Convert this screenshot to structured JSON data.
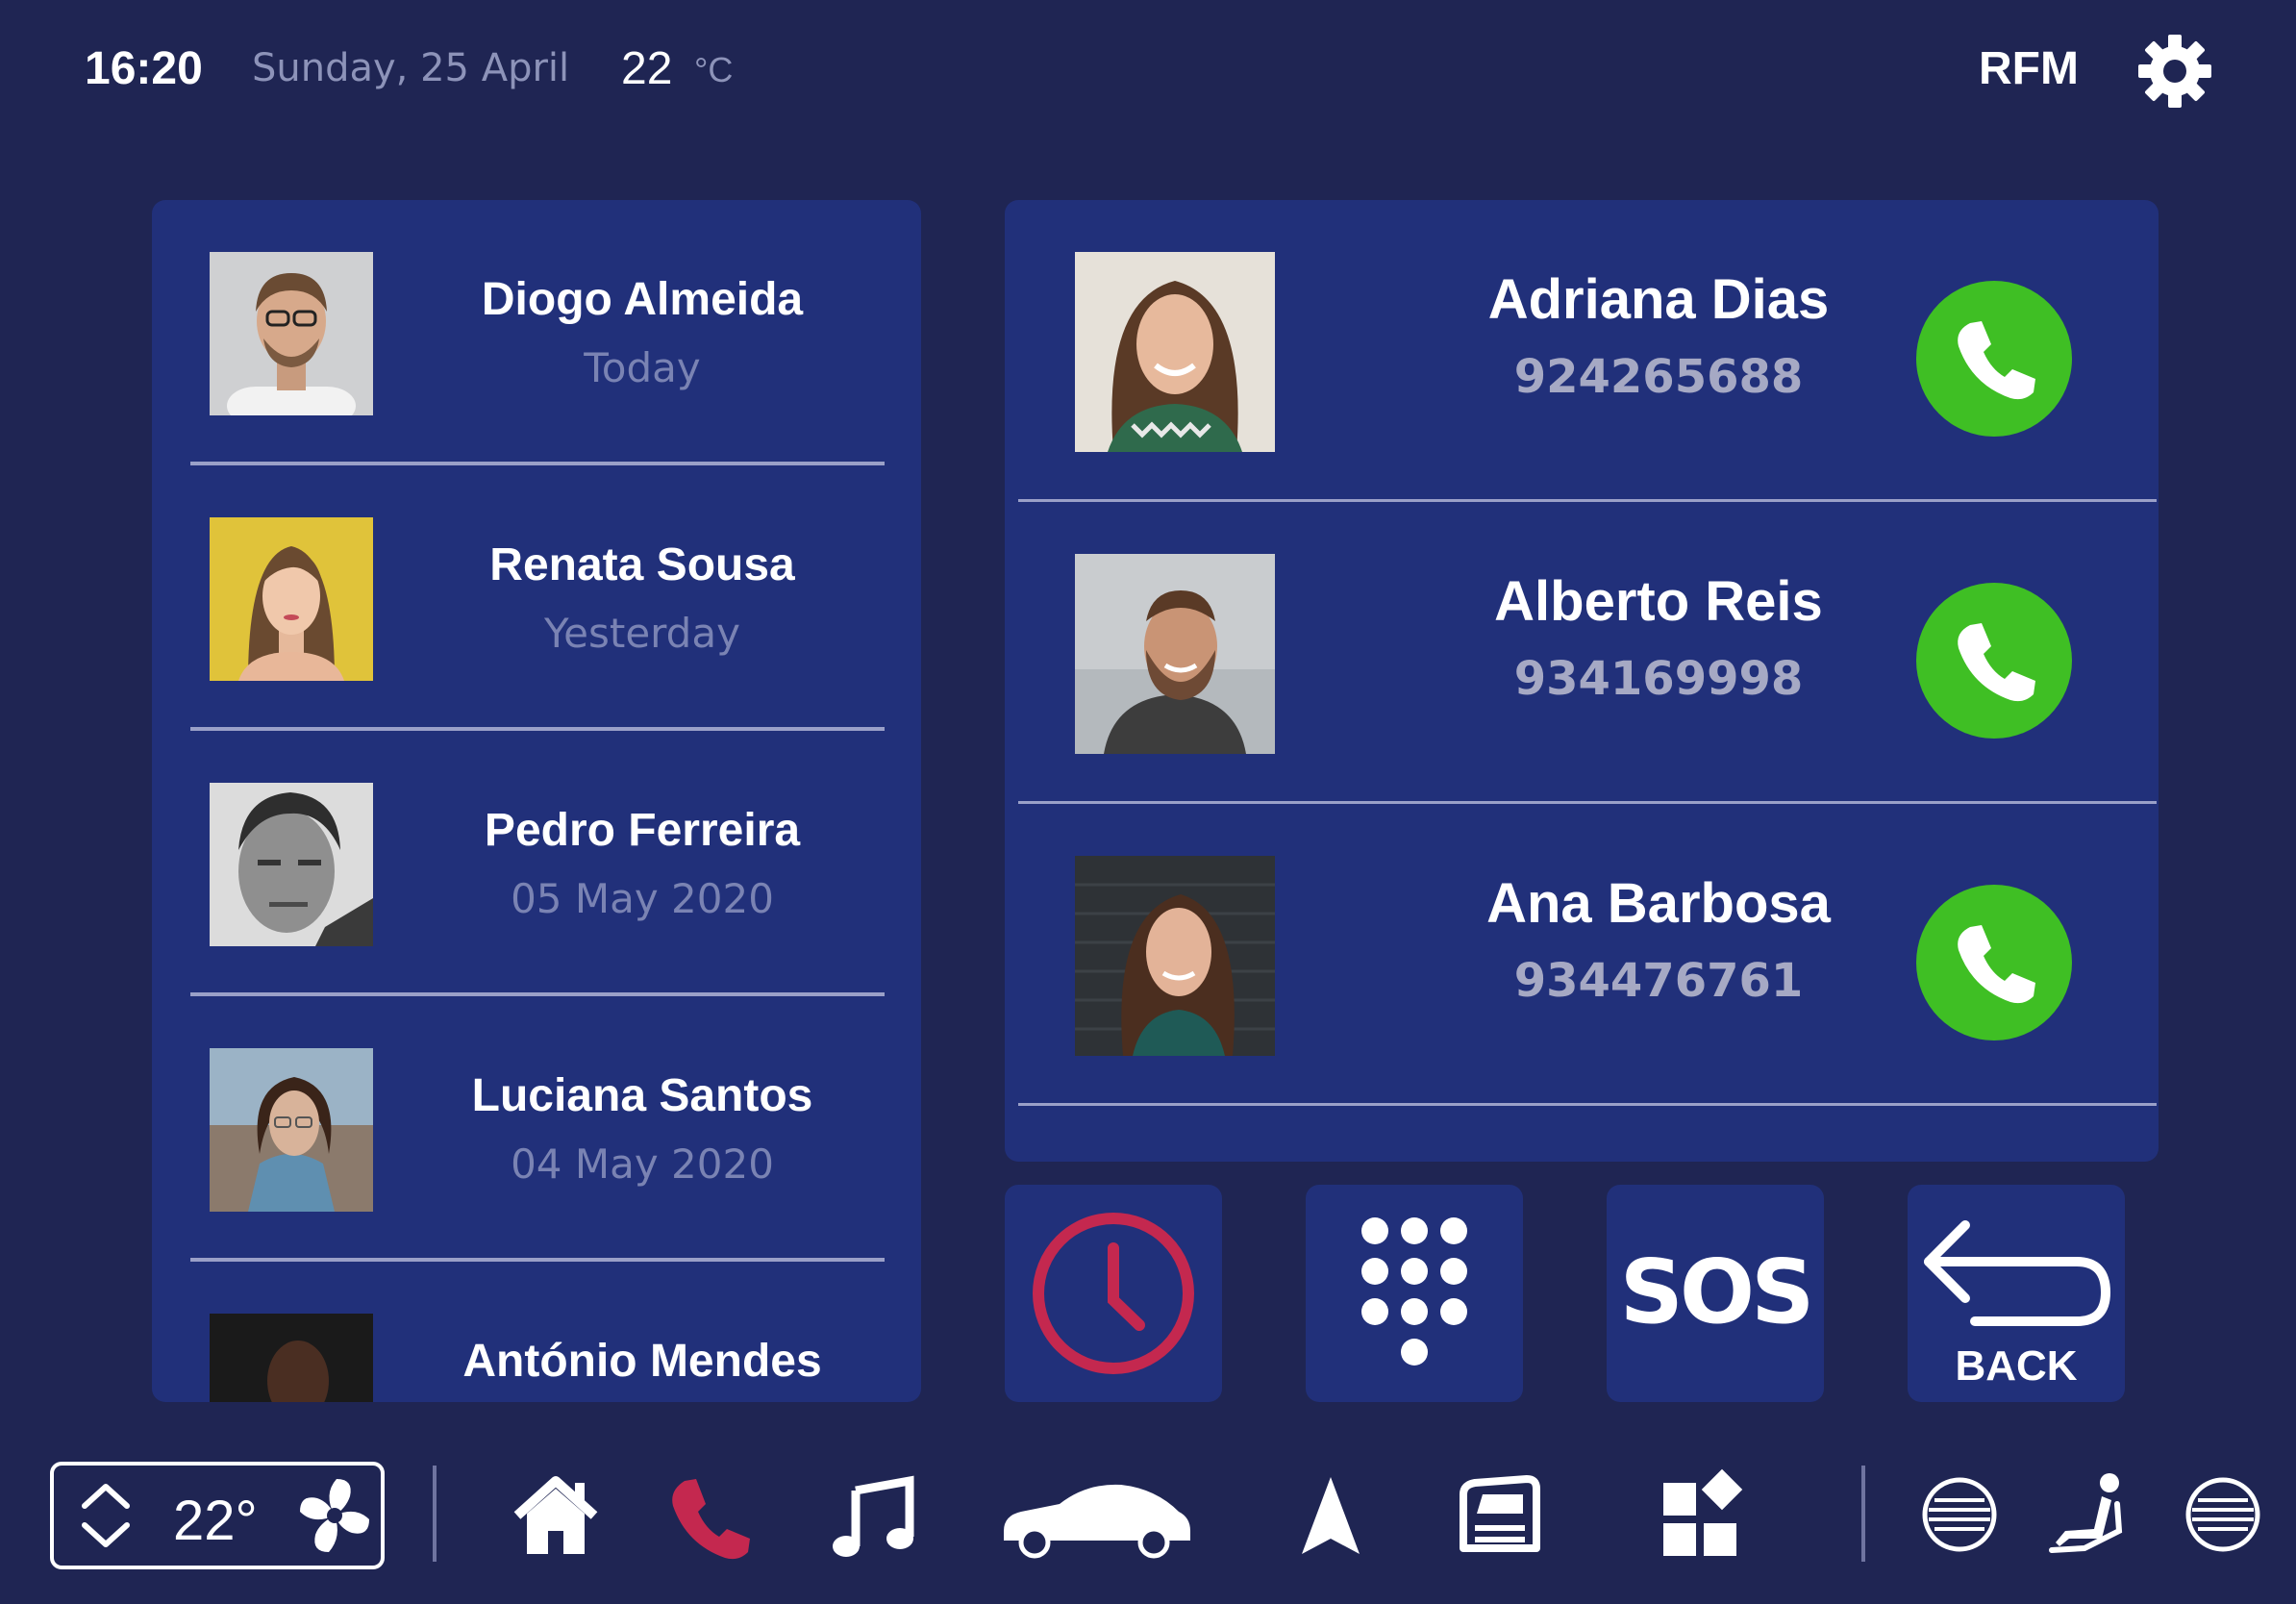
{
  "status_bar": {
    "time": "16:20",
    "date": "Sunday, 25 April",
    "temperature": "22",
    "temperature_unit": "°C",
    "radio": "RFM"
  },
  "recent_calls": [
    {
      "name": "Diogo Almeida",
      "when": "Today"
    },
    {
      "name": "Renata Sousa",
      "when": "Yesterday"
    },
    {
      "name": "Pedro Ferreira",
      "when": "05 May 2020"
    },
    {
      "name": "Luciana Santos",
      "when": "04 May 2020"
    },
    {
      "name": "António Mendes",
      "when": ""
    }
  ],
  "favorites": [
    {
      "name": "Adriana Dias",
      "number": "924265688"
    },
    {
      "name": "Alberto Reis",
      "number": "934169998"
    },
    {
      "name": "Ana Barbosa",
      "number": "934476761"
    }
  ],
  "actions": {
    "recent_icon": "clock-icon",
    "keypad_icon": "dialpad-icon",
    "sos_label": "SOS",
    "back_label": "BACK"
  },
  "climate": {
    "temperature": "22°"
  },
  "nav_icons": [
    "home-icon",
    "phone-icon",
    "music-icon",
    "car-icon",
    "navigation-icon",
    "vehicle-screen-icon",
    "apps-icon",
    "seat-heat-left-icon",
    "seat-icon",
    "seat-heat-right-icon"
  ],
  "colors": {
    "background": "#1f2553",
    "panel": "#21307a",
    "call_green": "#3fbf24",
    "accent_red": "#c4284f",
    "muted_text": "#8d93b9"
  }
}
